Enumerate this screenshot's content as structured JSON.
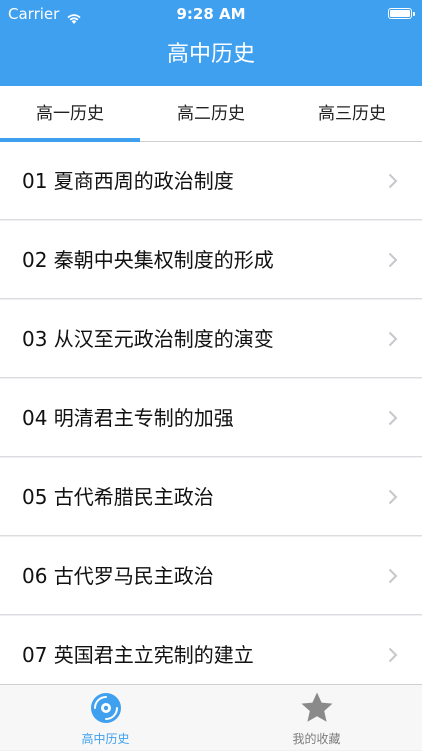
{
  "status_bar": {
    "carrier": "Carrier",
    "time": "9:28 AM"
  },
  "nav": {
    "title": "高中历史",
    "bg_color": "#3fa0f0"
  },
  "tabs": [
    {
      "label": "高一历史",
      "selected": true
    },
    {
      "label": "高二历史",
      "selected": false
    },
    {
      "label": "高三历史",
      "selected": false
    }
  ],
  "list": {
    "items": [
      {
        "label": "01 夏商西周的政治制度"
      },
      {
        "label": "02 秦朝中央集权制度的形成"
      },
      {
        "label": "03 从汉至元政治制度的演变"
      },
      {
        "label": "04 明清君主专制的加强"
      },
      {
        "label": "05 古代希腊民主政治"
      },
      {
        "label": "06 古代罗马民主政治"
      },
      {
        "label": "07 英国君主立宪制的建立"
      }
    ]
  },
  "tabbar": {
    "items": [
      {
        "label": "高中历史",
        "icon": "disc-icon",
        "active": true
      },
      {
        "label": "我的收藏",
        "icon": "star-icon",
        "active": false
      }
    ]
  }
}
